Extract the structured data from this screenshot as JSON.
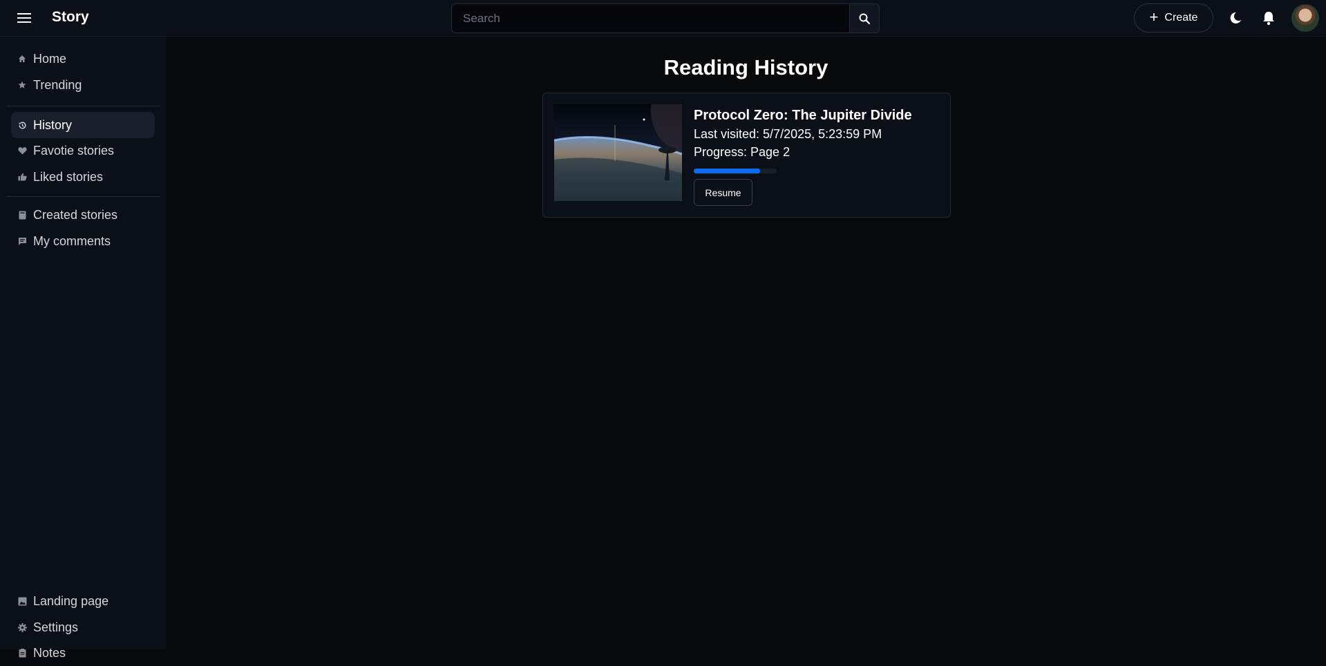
{
  "header": {
    "brand": "Story",
    "search_placeholder": "Search",
    "create_label": "Create"
  },
  "sidebar": {
    "items": [
      {
        "label": "Home",
        "icon": "home-icon"
      },
      {
        "label": "Trending",
        "icon": "star-icon"
      },
      {
        "label": "History",
        "icon": "history-icon",
        "active": true
      },
      {
        "label": "Favotie stories",
        "icon": "heart-icon"
      },
      {
        "label": "Liked stories",
        "icon": "thumbs-up-icon"
      },
      {
        "label": "Created stories",
        "icon": "book-icon"
      },
      {
        "label": "My comments",
        "icon": "comment-icon"
      },
      {
        "label": "Landing page",
        "icon": "image-icon"
      },
      {
        "label": "Settings",
        "icon": "gear-icon"
      },
      {
        "label": "Notes",
        "icon": "notes-icon"
      }
    ]
  },
  "main": {
    "title": "Reading History",
    "history": [
      {
        "title": "Protocol Zero: The Jupiter Divide",
        "last_visited": "Last visited: 5/7/2025, 5:23:59 PM",
        "progress_label": "Progress: Page 2",
        "progress_fraction": 0.8,
        "resume_label": "Resume"
      }
    ]
  },
  "colors": {
    "background": "#07090d",
    "panel": "#0b0f17",
    "accent": "#0a6cf0",
    "active_item": "#1a202b"
  }
}
